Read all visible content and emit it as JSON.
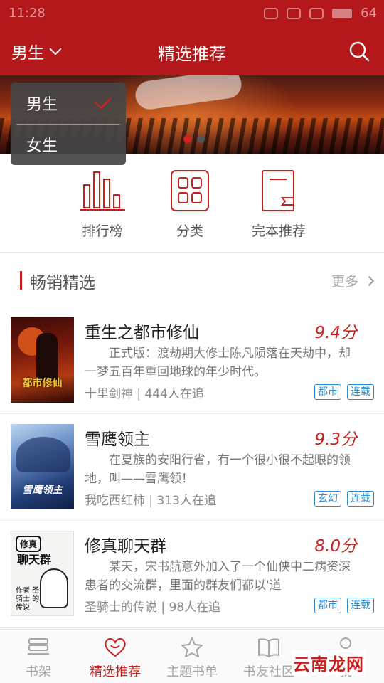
{
  "status_bar": {
    "time": "11:28",
    "battery": "64"
  },
  "header": {
    "gender_selected": "男生",
    "title": "精选推荐",
    "search_icon": "search-icon",
    "brand_color": "#b5181a"
  },
  "gender_dropdown": {
    "options": [
      {
        "label": "男生",
        "selected": true
      },
      {
        "label": "女生",
        "selected": false
      }
    ]
  },
  "banner": {
    "slide_count": 2,
    "active_slide": 1
  },
  "quick_nav": [
    {
      "label": "排行榜",
      "icon": "bar-chart-icon"
    },
    {
      "label": "分类",
      "icon": "grid-icon"
    },
    {
      "label": "完本推荐",
      "icon": "book-icon"
    }
  ],
  "section": {
    "title": "畅销精选",
    "more_label": "更多"
  },
  "books": [
    {
      "title": "重生之都市修仙",
      "score": "9.4分",
      "description": "正式版：渡劫期大修士陈凡陨落在天劫中，却一梦五百年重回地球的年少时代。",
      "author": "十里剑神",
      "followers": "444人在追",
      "tags": [
        "都市",
        "连载"
      ],
      "cover_text": "都市修仙"
    },
    {
      "title": "雪鹰领主",
      "score": "9.3分",
      "description": "在夏族的安阳行省，有一个很小很不起眼的领地，叫——雪鹰领！",
      "author": "我吃西红柿",
      "followers": "313人在追",
      "tags": [
        "玄幻",
        "连载"
      ],
      "cover_text": "雪鹰领主"
    },
    {
      "title": "修真聊天群",
      "score": "8.0分",
      "description": "某天，宋书航意外加入了一个仙侠中二病资深患者的交流群，里面的群友们都以'道",
      "author": "圣骑士的传说",
      "followers": "98人在追",
      "tags": [
        "都市",
        "连载"
      ],
      "cover_badge": "修真",
      "cover_text": "聊天群",
      "cover_author": "作者 圣骑士 的传说"
    }
  ],
  "tab_bar": [
    {
      "label": "书架",
      "icon": "bookshelf-icon",
      "active": false
    },
    {
      "label": "精选推荐",
      "icon": "heart-icon",
      "active": true
    },
    {
      "label": "主题书单",
      "icon": "star-icon",
      "active": false
    },
    {
      "label": "书友社区",
      "icon": "open-book-icon",
      "active": false
    },
    {
      "label": "我",
      "icon": "user-icon",
      "active": false
    }
  ],
  "watermark": "云南龙网",
  "accent_color": "#c8201f",
  "tag_color": "#2a8fd3"
}
